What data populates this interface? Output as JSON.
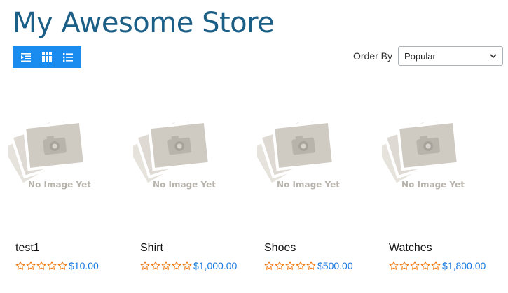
{
  "store": {
    "title": "My Awesome Store"
  },
  "toolbar": {
    "buttons": [
      {
        "icon": "indent-icon"
      },
      {
        "icon": "grid-icon"
      },
      {
        "icon": "list-icon"
      }
    ]
  },
  "order": {
    "label": "Order By",
    "selected": "Popular"
  },
  "placeholder": {
    "line1": "No Image Yet"
  },
  "products": [
    {
      "name": "test1",
      "price": "$10.00"
    },
    {
      "name": "Shirt",
      "price": "$1,000.00"
    },
    {
      "name": "Shoes",
      "price": "$500.00"
    },
    {
      "name": "Watches",
      "price": "$1,800.00"
    }
  ],
  "colors": {
    "accent": "#1a8cf0",
    "title": "#1b5e86",
    "star": "#f07a12",
    "price": "#1a7ae0"
  }
}
